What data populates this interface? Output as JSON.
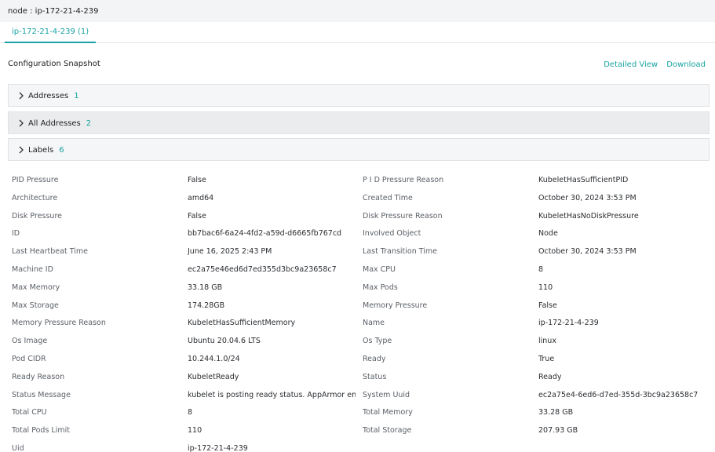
{
  "header": {
    "title": "node : ip-172-21-4-239"
  },
  "tabs": [
    {
      "label": "ip-172-21-4-239 (1)"
    }
  ],
  "section": {
    "title": "Configuration Snapshot",
    "detailed_view": "Detailed View",
    "download": "Download"
  },
  "accordions": [
    {
      "label": "Addresses",
      "count": "1"
    },
    {
      "label": "All Addresses",
      "count": "2"
    },
    {
      "label": "Labels",
      "count": "6"
    }
  ],
  "properties": [
    {
      "k1": "PID Pressure",
      "v1": "False",
      "k2": "P I D Pressure Reason",
      "v2": "KubeletHasSufficientPID"
    },
    {
      "k1": "Architecture",
      "v1": "amd64",
      "k2": "Created Time",
      "v2": "October 30, 2024 3:53 PM"
    },
    {
      "k1": "Disk Pressure",
      "v1": "False",
      "k2": "Disk Pressure Reason",
      "v2": "KubeletHasNoDiskPressure"
    },
    {
      "k1": "ID",
      "v1": "bb7bac6f-6a24-4fd2-a59d-d6665fb767cd",
      "k2": "Involved Object",
      "v2": "Node"
    },
    {
      "k1": "Last Heartbeat Time",
      "v1": "June 16, 2025 2:43 PM",
      "k2": "Last Transition Time",
      "v2": "October 30, 2024 3:53 PM"
    },
    {
      "k1": "Machine ID",
      "v1": "ec2a75e46ed6d7ed355d3bc9a23658c7",
      "k2": "Max CPU",
      "v2": "8"
    },
    {
      "k1": "Max Memory",
      "v1": "33.18 GB",
      "k2": "Max Pods",
      "v2": "110"
    },
    {
      "k1": "Max Storage",
      "v1": "174.28GB",
      "k2": "Memory Pressure",
      "v2": "False"
    },
    {
      "k1": "Memory Pressure Reason",
      "v1": "KubeletHasSufficientMemory",
      "k2": "Name",
      "v2": "ip-172-21-4-239"
    },
    {
      "k1": "Os Image",
      "v1": "Ubuntu 20.04.6 LTS",
      "k2": "Os Type",
      "v2": "linux"
    },
    {
      "k1": "Pod CIDR",
      "v1": "10.244.1.0/24",
      "k2": "Ready",
      "v2": "True"
    },
    {
      "k1": "Ready Reason",
      "v1": "KubeletReady",
      "k2": "Status",
      "v2": "Ready"
    },
    {
      "k1": "Status Message",
      "v1": "kubelet is posting ready status. AppArmor en...",
      "k2": "System Uuid",
      "v2": "ec2a75e4-6ed6-d7ed-355d-3bc9a23658c7"
    },
    {
      "k1": "Total CPU",
      "v1": "8",
      "k2": "Total Memory",
      "v2": "33.28 GB"
    },
    {
      "k1": "Total Pods Limit",
      "v1": "110",
      "k2": "Total Storage",
      "v2": "207.93 GB"
    },
    {
      "k1": "Uid",
      "v1": "ip-172-21-4-239",
      "k2": "",
      "v2": ""
    }
  ],
  "colors": {
    "accent": "#1aa3a3",
    "header_bg": "#f3f4f5",
    "accordion_bg": "#f5f6f7"
  },
  "icons": {
    "accordion": "chevron-right-icon"
  }
}
